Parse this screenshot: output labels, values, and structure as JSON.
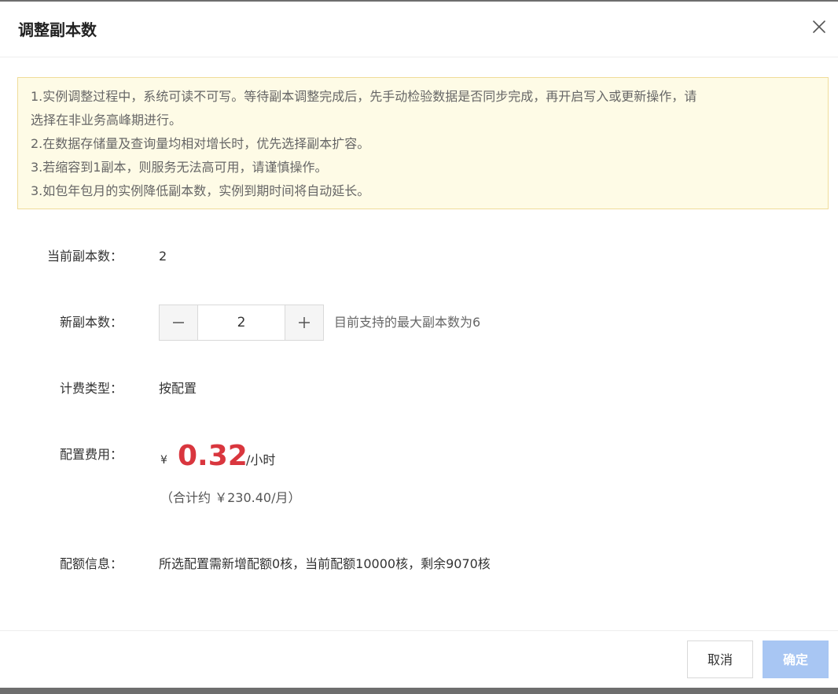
{
  "dialog": {
    "title": "调整副本数"
  },
  "notice": {
    "lines": [
      "1.实例调整过程中，系统可读不可写。等待副本调整完成后，先手动检验数据是否同步完成，再开启写入或更新操作，请",
      "选择在非业务高峰期进行。",
      "2.在数据存储量及查询量均相对增长时，优先选择副本扩容。",
      "3.若缩容到1副本，则服务无法高可用，请谨慎操作。",
      "3.如包年包月的实例降低副本数，实例到期时间将自动延长。"
    ]
  },
  "form": {
    "current": {
      "label": "当前副本数：",
      "value": "2"
    },
    "new": {
      "label": "新副本数：",
      "value": "2",
      "hint": "目前支持的最大副本数为6"
    },
    "billing": {
      "label": "计费类型：",
      "value": "按配置"
    },
    "cost": {
      "label": "配置费用：",
      "currency": "¥",
      "price": "0.32",
      "unit": "/小时",
      "total": "（合计约 ￥230.40/月）"
    },
    "quota": {
      "label": "配额信息：",
      "value": "所选配置需新增配额0核，当前配额10000核，剩余9070核"
    }
  },
  "footer": {
    "cancel_label": "取消",
    "confirm_label": "确定"
  },
  "colors": {
    "price": "#d9363e",
    "confirm_bg": "#a8c6f3",
    "notice_bg": "#fefbe6",
    "notice_border": "#f0dc9a"
  },
  "icons": {
    "close": "close-icon",
    "minus": "minus-icon",
    "plus": "plus-icon"
  }
}
